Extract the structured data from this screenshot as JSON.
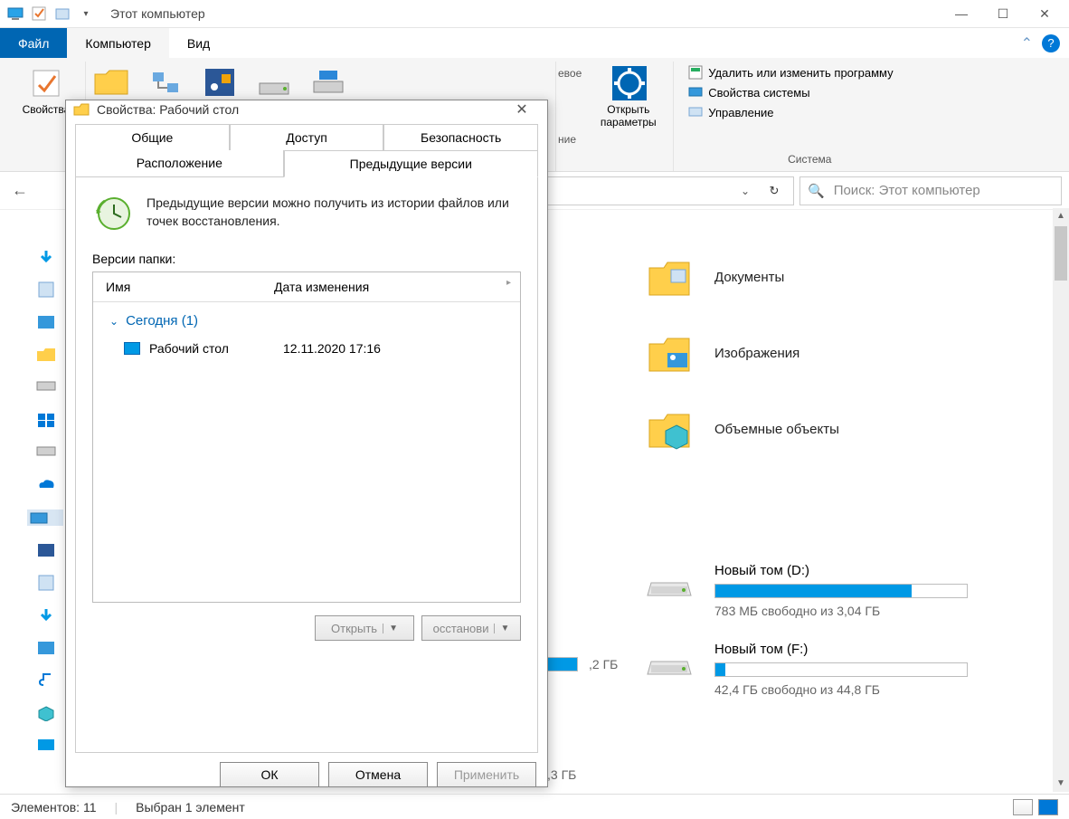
{
  "window": {
    "title": "Этот компьютер"
  },
  "ribbon": {
    "tabs": {
      "file": "Файл",
      "computer": "Компьютер",
      "view": "Вид"
    },
    "properties": "Свойства",
    "open_params_l1": "Открыть",
    "open_params_l2": "параметры",
    "system_group": "Система",
    "uninstall": "Удалить или изменить программу",
    "sysprops": "Свойства системы",
    "manage": "Управление",
    "partial_right": "евое",
    "partial_right2": "ние"
  },
  "nav": {
    "search_placeholder": "Поиск: Этот компьютер"
  },
  "content": {
    "folders": [
      {
        "name": "Документы",
        "icon": "documents"
      },
      {
        "name": "Изображения",
        "icon": "pictures"
      },
      {
        "name": "Объемные объекты",
        "icon": "3d"
      }
    ],
    "drives": [
      {
        "name": "Новый том (D:)",
        "free": "783 МБ свободно из 3,04 ГБ",
        "fill_pct": 78
      },
      {
        "name": "Новый том (F:)",
        "free": "42,4 ГБ свободно из 44,8 ГБ",
        "fill_pct": 4
      }
    ],
    "peek1": ",2 ГБ",
    "peek2": ",3 ГБ"
  },
  "dialog": {
    "title": "Свойства: Рабочий стол",
    "tabs": {
      "general": "Общие",
      "sharing": "Доступ",
      "security": "Безопасность",
      "location": "Расположение",
      "previous": "Предыдущие версии"
    },
    "info_text": "Предыдущие версии можно получить из истории файлов или точек восстановления.",
    "versions_label": "Версии папки:",
    "col_name": "Имя",
    "col_date": "Дата изменения",
    "group": "Сегодня (1)",
    "item_name": "Рабочий стол",
    "item_date": "12.11.2020 17:16",
    "open_btn": "Открыть",
    "restore_btn": "осстанови",
    "ok": "ОК",
    "cancel": "Отмена",
    "apply": "Применить"
  },
  "status": {
    "count": "Элементов: 11",
    "selected": "Выбран 1 элемент"
  }
}
